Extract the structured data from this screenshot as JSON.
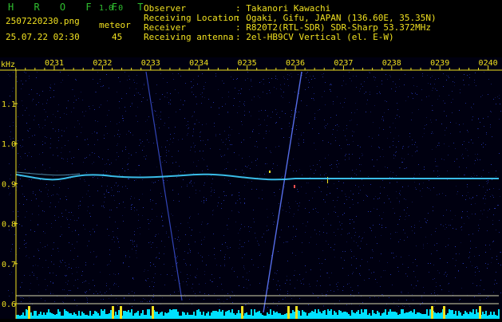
{
  "header": {
    "app_title": "H R O F F T",
    "version": "1.0.0",
    "filename": "2507220230.png",
    "datetime": "25.07.22 02:30",
    "meteor_label": "meteor",
    "meteor_count": "45",
    "info": [
      {
        "key": "Observer",
        "value": ": Takanori Kawachi"
      },
      {
        "key": "Receiving Location",
        "value": ": Ogaki, Gifu, JAPAN (136.60E, 35.35N)"
      },
      {
        "key": "Receiver",
        "value": ": R820T2(RTL-SDR) SDR-Sharp 53.372MHz"
      },
      {
        "key": "Receiving antenna",
        "value": ": 2el-HB9CV Vertical (el. E-W)"
      }
    ]
  },
  "spectrogram": {
    "y_unit": "kHz",
    "x_ticks": [
      "0231",
      "0232",
      "0233",
      "0234",
      "0235",
      "0236",
      "0237",
      "0238",
      "0239",
      "0240"
    ],
    "y_ticks": [
      "1.1",
      "1.0",
      "0.9",
      "0.8",
      "0.7",
      "0.6"
    ],
    "colors": {
      "background": "#000010",
      "noise": "#2a3cc8",
      "carrier": "#3fd0ff",
      "axis": "#f0e020",
      "bars": "#00e0ff"
    }
  }
}
